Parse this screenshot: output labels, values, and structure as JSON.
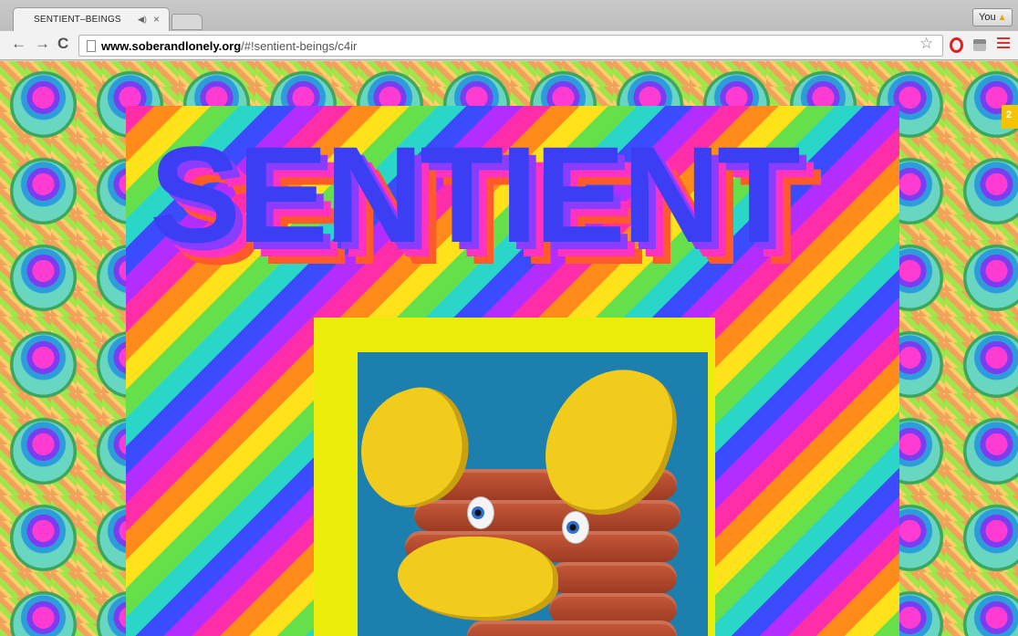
{
  "browser": {
    "tab_title": "SENTIENT–BEINGS",
    "tab_audio_icon": "speaker-icon",
    "tab_close": "×",
    "profile_label": "You",
    "profile_warning": "▲",
    "nav": {
      "back": "←",
      "forward": "→",
      "reload": "C"
    },
    "url_host": "www.soberandlonely.org",
    "url_path": "/#!sentient-beings/c4ir",
    "bookmark_star": "☆"
  },
  "page": {
    "sidebar_badge": "2",
    "poster_title": "SENTIENT"
  },
  "colors": {
    "title_blue": "#3b3ef2",
    "frame_yellow": "#ecec0a",
    "photo_blue": "#1d7fae"
  }
}
